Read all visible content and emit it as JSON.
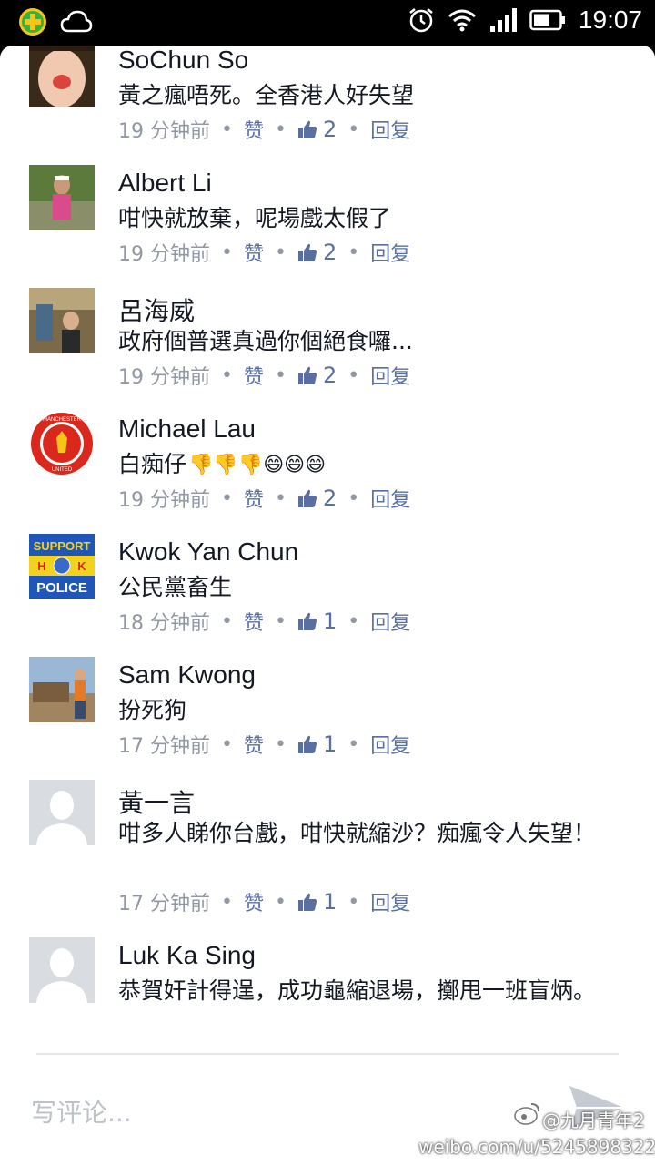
{
  "status_bar": {
    "time": "19:07",
    "icons": [
      "add-icon",
      "cloud-icon",
      "alarm-icon",
      "wifi-icon",
      "signal-icon",
      "battery-icon"
    ]
  },
  "comments": [
    {
      "name": "SoChun So",
      "text": "黃之瘋唔死。全香港人好失望",
      "time": "19 分钟前",
      "like_label": "赞",
      "likes": "2",
      "reply_label": "回复"
    },
    {
      "name": "Albert Li",
      "text": "咁快就放棄，呢場戲太假了",
      "time": "19 分钟前",
      "like_label": "赞",
      "likes": "2",
      "reply_label": "回复"
    },
    {
      "name": "呂海威",
      "text": "政府個普選真過你個絕食囉...",
      "time": "19 分钟前",
      "like_label": "赞",
      "likes": "2",
      "reply_label": "回复"
    },
    {
      "name": "Michael Lau",
      "text": "白痴仔",
      "text_emoji": "👎👎👎😄😄😄",
      "time": "19 分钟前",
      "like_label": "赞",
      "likes": "2",
      "reply_label": "回复",
      "avatar_text": [
        "MANCHESTER",
        "UNITED"
      ]
    },
    {
      "name": "Kwok Yan Chun",
      "text": "公民黨畜生",
      "time": "18 分钟前",
      "like_label": "赞",
      "likes": "1",
      "reply_label": "回复",
      "avatar_text": [
        "SUPPORT",
        "H",
        "K",
        "POLICE"
      ]
    },
    {
      "name": "Sam Kwong",
      "text": "扮死狗",
      "time": "17 分钟前",
      "like_label": "赞",
      "likes": "1",
      "reply_label": "回复"
    },
    {
      "name": "黃一言",
      "text": "咁多人睇你台戲，咁快就縮沙？痴瘋令人失望！",
      "time": "17 分钟前",
      "like_label": "赞",
      "likes": "1",
      "reply_label": "回复"
    },
    {
      "name": "Luk Ka Sing",
      "text": "恭賀奸計得逞，成功龜縮退場，擲甩一班盲炳。",
      "time": "",
      "like_label": "",
      "likes": "",
      "reply_label": ""
    }
  ],
  "input": {
    "placeholder": "写评论..."
  },
  "watermark": {
    "handle": "@九月青年2",
    "url": "weibo.com/u/5245898322"
  },
  "colors": {
    "name": "#141823",
    "meta": "#9197a3",
    "link": "#5a6fa0",
    "bg": "#ffffff"
  }
}
